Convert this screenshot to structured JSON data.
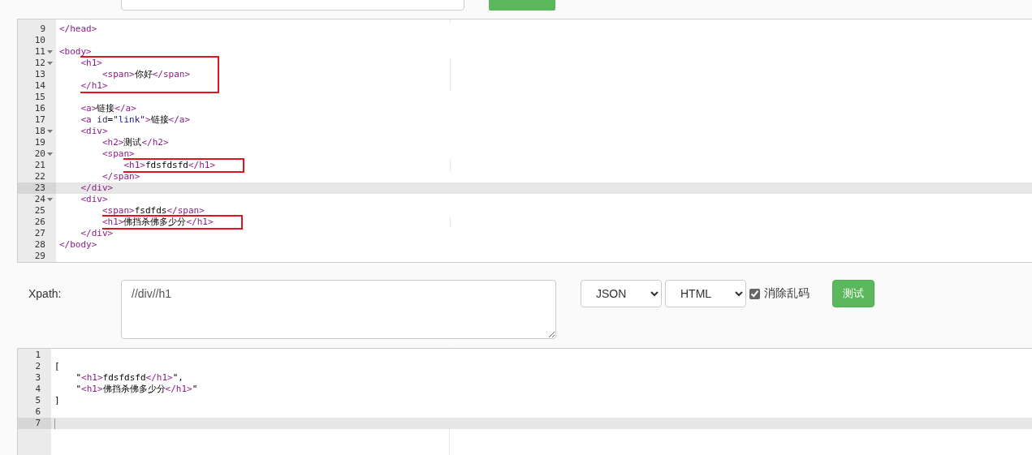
{
  "source_editor": {
    "lines": [
      {
        "number": "9",
        "fold": false,
        "active": false,
        "box": false,
        "tokens": [
          {
            "kind": "tag",
            "t": "</head>"
          }
        ]
      },
      {
        "number": "10",
        "fold": false,
        "active": false,
        "box": false
      },
      {
        "number": "11",
        "fold": true,
        "active": false,
        "box": false,
        "tokens": [
          {
            "kind": "tag",
            "t": "<body>"
          }
        ],
        "children": [
          {
            "number": "12",
            "fold": true,
            "active": false,
            "box": true,
            "tokens": [
              {
                "kind": "tag",
                "t": "<h1>"
              }
            ],
            "children": [
              {
                "number": "13",
                "fold": false,
                "active": false,
                "box": true,
                "tokens": [
                  {
                    "kind": "tag",
                    "t": "<span>"
                  },
                  {
                    "kind": "text",
                    "t": "你好"
                  },
                  {
                    "kind": "tag",
                    "t": "</span>"
                  }
                ]
              }
            ]
          },
          {
            "number": "14",
            "fold": false,
            "active": false,
            "box": true,
            "tokens": [
              {
                "kind": "tag",
                "t": "</h1>"
              }
            ]
          },
          {
            "number": "15",
            "fold": false,
            "active": false,
            "box": false
          },
          {
            "number": "16",
            "fold": false,
            "active": false,
            "box": false,
            "tokens": [
              {
                "kind": "tag",
                "t": "<a>"
              },
              {
                "kind": "text",
                "t": "链接"
              },
              {
                "kind": "tag",
                "t": "</a>"
              }
            ]
          },
          {
            "number": "17",
            "fold": false,
            "active": false,
            "box": false,
            "tokens": [
              {
                "kind": "tag",
                "t": "<a "
              },
              {
                "kind": "attr",
                "t": "id"
              },
              {
                "kind": "text",
                "t": "="
              },
              {
                "kind": "string",
                "t": "\"link\""
              },
              {
                "kind": "tag",
                "t": ">"
              },
              {
                "kind": "text",
                "t": "链接"
              },
              {
                "kind": "tag",
                "t": "</a>"
              }
            ]
          },
          {
            "number": "18",
            "fold": true,
            "active": false,
            "box": false,
            "tokens": [
              {
                "kind": "tag",
                "t": "<div>"
              }
            ],
            "children": [
              {
                "number": "19",
                "fold": false,
                "active": false,
                "box": false,
                "tokens": [
                  {
                    "kind": "tag",
                    "t": "<h2>"
                  },
                  {
                    "kind": "text",
                    "t": "测试"
                  },
                  {
                    "kind": "tag",
                    "t": "</h2>"
                  }
                ]
              },
              {
                "number": "20",
                "fold": true,
                "active": false,
                "box": false,
                "tokens": [
                  {
                    "kind": "tag",
                    "t": "<span>"
                  }
                ],
                "children": [
                  {
                    "number": "21",
                    "fold": false,
                    "active": false,
                    "box": true,
                    "tokens": [
                      {
                        "kind": "tag",
                        "t": "<h1>"
                      },
                      {
                        "kind": "text",
                        "t": "fdsfdsfd"
                      },
                      {
                        "kind": "tag",
                        "t": "</h1>"
                      }
                    ]
                  }
                ]
              },
              {
                "number": "22",
                "fold": false,
                "active": false,
                "box": false,
                "tokens": [
                  {
                    "kind": "tag",
                    "t": "</span>"
                  }
                ]
              }
            ]
          },
          {
            "number": "23",
            "fold": false,
            "active": true,
            "box": false,
            "tokens": [
              {
                "kind": "tag",
                "t": "</div>"
              }
            ]
          },
          {
            "number": "24",
            "fold": true,
            "active": false,
            "box": false,
            "tokens": [
              {
                "kind": "tag",
                "t": "<div>"
              }
            ],
            "children": [
              {
                "number": "25",
                "fold": false,
                "active": false,
                "box": false,
                "tokens": [
                  {
                    "kind": "tag",
                    "t": "<span>"
                  },
                  {
                    "kind": "text",
                    "t": "fsdfds"
                  },
                  {
                    "kind": "tag",
                    "t": "</span>"
                  }
                ]
              },
              {
                "number": "26",
                "fold": false,
                "active": false,
                "box": true,
                "tokens": [
                  {
                    "kind": "tag",
                    "t": "<h1>"
                  },
                  {
                    "kind": "text",
                    "t": "佛挡杀佛多少分"
                  },
                  {
                    "kind": "tag",
                    "t": "</h1>"
                  }
                ]
              }
            ]
          },
          {
            "number": "27",
            "fold": false,
            "active": false,
            "box": false,
            "tokens": [
              {
                "kind": "tag",
                "t": "</div>"
              }
            ]
          }
        ]
      },
      {
        "number": "28",
        "fold": false,
        "active": false,
        "box": false,
        "tokens": [
          {
            "kind": "tag",
            "t": "</body>"
          }
        ]
      },
      {
        "number": "29",
        "fold": false,
        "active": false,
        "box": false
      }
    ]
  },
  "query_row": {
    "label": "Xpath:",
    "xpath_value": "//div//h1",
    "output_format": "JSON",
    "input_format": "HTML",
    "clean_option": {
      "label": "消除乱码",
      "checked": true
    },
    "test_button": "测试"
  },
  "result_editor": {
    "lines": [
      {
        "number": "1",
        "fold": false,
        "active": false,
        "box": false
      },
      {
        "number": "2",
        "fold": false,
        "active": false,
        "box": false,
        "tokens": [
          {
            "kind": "text",
            "t": "["
          }
        ],
        "children": [
          {
            "number": "3",
            "fold": false,
            "active": false,
            "box": false,
            "tokens": [
              {
                "kind": "text",
                "t": "\""
              },
              {
                "kind": "tag",
                "t": "<h1>"
              },
              {
                "kind": "text",
                "t": "fdsfdsfd"
              },
              {
                "kind": "tag",
                "t": "</h1>"
              },
              {
                "kind": "text",
                "t": "\","
              }
            ]
          },
          {
            "number": "4",
            "fold": false,
            "active": false,
            "box": false,
            "tokens": [
              {
                "kind": "text",
                "t": "\""
              },
              {
                "kind": "tag",
                "t": "<h1>"
              },
              {
                "kind": "text",
                "t": "佛挡杀佛多少分"
              },
              {
                "kind": "tag",
                "t": "</h1>"
              },
              {
                "kind": "text",
                "t": "\""
              }
            ]
          }
        ]
      },
      {
        "number": "5",
        "fold": false,
        "active": false,
        "box": false,
        "tokens": [
          {
            "kind": "text",
            "t": "]"
          }
        ]
      },
      {
        "number": "6",
        "fold": false,
        "active": false,
        "box": false
      },
      {
        "number": "7",
        "fold": false,
        "active": true,
        "box": false
      }
    ]
  }
}
